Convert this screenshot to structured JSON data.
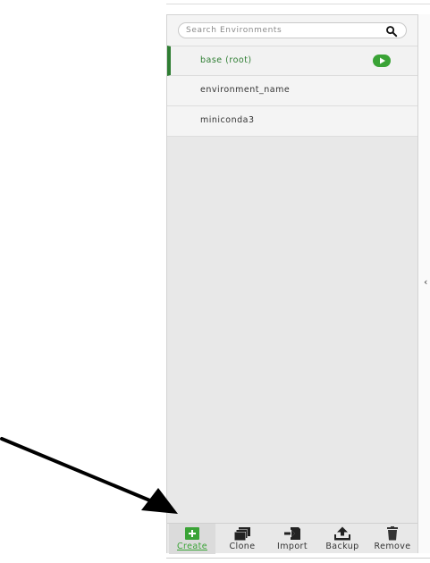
{
  "search": {
    "placeholder": "Search Environments"
  },
  "environments": [
    {
      "label": "base (root)",
      "active": true
    },
    {
      "label": "environment_name",
      "active": false
    },
    {
      "label": "miniconda3",
      "active": false
    }
  ],
  "toolbar": {
    "create": "Create",
    "clone": "Clone",
    "import": "Import",
    "backup": "Backup",
    "remove": "Remove"
  },
  "colors": {
    "accent": "#2e7d32",
    "create_green": "#3aa336",
    "panel_bg": "#e8e8e8"
  },
  "icons": {
    "search": "magnifier-icon",
    "run": "play-icon",
    "create": "plus-square-icon",
    "clone": "stacked-windows-icon",
    "import": "import-arrow-icon",
    "backup": "upload-tray-icon",
    "remove": "trash-icon",
    "collapse": "chevron-left-icon"
  }
}
